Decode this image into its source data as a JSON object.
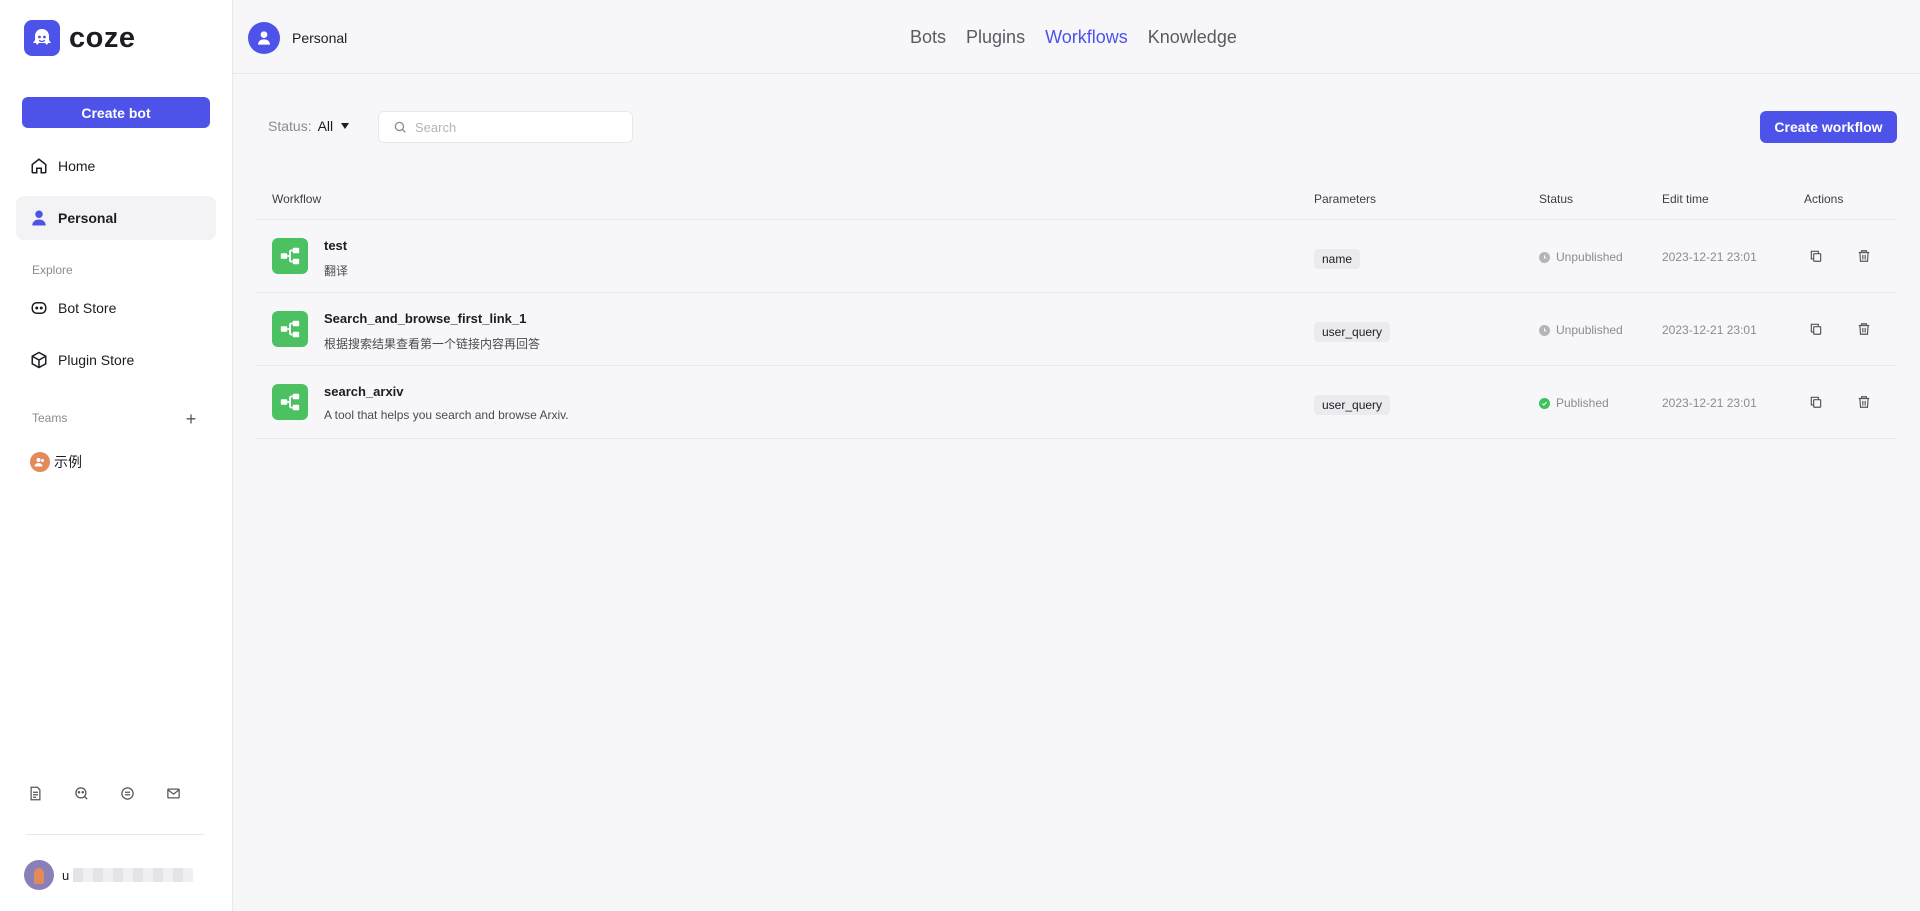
{
  "app": {
    "logo_text": "coze"
  },
  "sidebar": {
    "create_bot_label": "Create bot",
    "nav": [
      {
        "label": "Home",
        "icon": "home-icon"
      },
      {
        "label": "Personal",
        "icon": "person-icon"
      }
    ],
    "explore_label": "Explore",
    "explore": [
      {
        "label": "Bot Store",
        "icon": "bot-icon"
      },
      {
        "label": "Plugin Store",
        "icon": "cube-icon"
      }
    ],
    "teams_label": "Teams",
    "teams": [
      {
        "label": "示例"
      }
    ],
    "user_initial": "u"
  },
  "header": {
    "space_name": "Personal",
    "tabs": [
      {
        "label": "Bots"
      },
      {
        "label": "Plugins"
      },
      {
        "label": "Workflows"
      },
      {
        "label": "Knowledge"
      }
    ],
    "active_tab": "Workflows"
  },
  "toolbar": {
    "status_label": "Status:",
    "status_value": "All",
    "search_placeholder": "Search",
    "create_workflow_label": "Create workflow"
  },
  "table": {
    "columns": {
      "workflow": "Workflow",
      "parameters": "Parameters",
      "status": "Status",
      "edit_time": "Edit time",
      "actions": "Actions"
    },
    "rows": [
      {
        "name": "test",
        "desc": "翻译",
        "param": "name",
        "status": "Unpublished",
        "status_color": "#b4b4bb",
        "edit_time": "2023-12-21 23:01"
      },
      {
        "name": "Search_and_browse_first_link_1",
        "desc": "根据搜索结果查看第一个链接内容再回答",
        "param": "user_query",
        "status": "Unpublished",
        "status_color": "#b4b4bb",
        "edit_time": "2023-12-21 23:01"
      },
      {
        "name": "search_arxiv",
        "desc": "A tool that helps you search and browse Arxiv.",
        "param": "user_query",
        "status": "Published",
        "status_color": "#3ec25a",
        "edit_time": "2023-12-21 23:01"
      }
    ]
  },
  "colors": {
    "accent": "#4d53e8",
    "workflow_icon": "#4cc161"
  }
}
